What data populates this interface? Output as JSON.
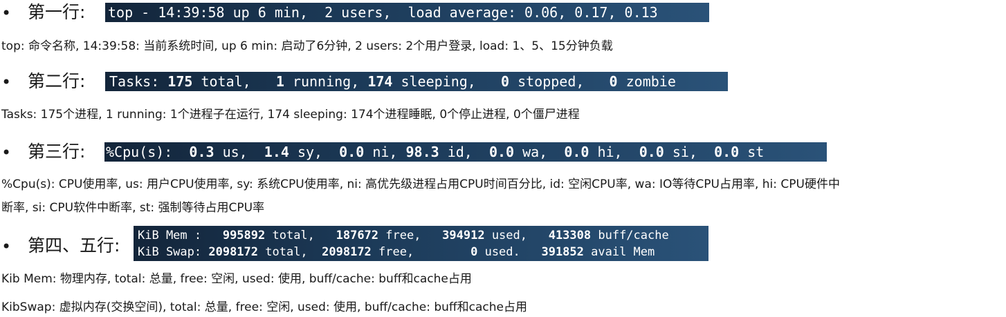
{
  "sections": [
    {
      "bullet": "•",
      "heading": "第一行:",
      "terminal": {
        "lines": [
          [
            {
              "t": "top - 14:39:58 up 6 min,  2 users,  load average: 0.06, 0.17, 0.13",
              "b": false
            }
          ]
        ]
      },
      "description": [
        "top: 命令名称, 14:39:58: 当前系统时间, up 6 min: 启动了6分钟, 2 users: 2个用户登录, load: 1、5、15分钟负载"
      ]
    },
    {
      "bullet": "•",
      "heading": "第二行:",
      "terminal": {
        "lines": [
          [
            {
              "t": "Tasks: ",
              "b": false
            },
            {
              "t": "175",
              "b": true
            },
            {
              "t": " total,   ",
              "b": false
            },
            {
              "t": "1",
              "b": true
            },
            {
              "t": " running, ",
              "b": false
            },
            {
              "t": "174",
              "b": true
            },
            {
              "t": " sleeping,   ",
              "b": false
            },
            {
              "t": "0",
              "b": true
            },
            {
              "t": " stopped,   ",
              "b": false
            },
            {
              "t": "0",
              "b": true
            },
            {
              "t": " zombie",
              "b": false
            }
          ]
        ]
      },
      "description": [
        "Tasks: 175个进程, 1 running: 1个进程子在运行, 174 sleeping: 174个进程睡眠, 0个停止进程, 0个僵尸进程"
      ]
    },
    {
      "bullet": "•",
      "heading": "第三行:",
      "terminal": {
        "lines": [
          [
            {
              "t": "%Cpu(s):  ",
              "b": false
            },
            {
              "t": "0.3",
              "b": true
            },
            {
              "t": " us,  ",
              "b": false
            },
            {
              "t": "1.4",
              "b": true
            },
            {
              "t": " sy,  ",
              "b": false
            },
            {
              "t": "0.0",
              "b": true
            },
            {
              "t": " ni, ",
              "b": false
            },
            {
              "t": "98.3",
              "b": true
            },
            {
              "t": " id,  ",
              "b": false
            },
            {
              "t": "0.0",
              "b": true
            },
            {
              "t": " wa,  ",
              "b": false
            },
            {
              "t": "0.0",
              "b": true
            },
            {
              "t": " hi,  ",
              "b": false
            },
            {
              "t": "0.0",
              "b": true
            },
            {
              "t": " si,  ",
              "b": false
            },
            {
              "t": "0.0",
              "b": true
            },
            {
              "t": " st",
              "b": false
            }
          ]
        ]
      },
      "description": [
        "%Cpu(s): CPU使用率, us: 用户CPU使用率, sy: 系统CPU使用率, ni: 高优先级进程占用CPU时间百分比, id: 空闲CPU率, wa: IO等待CPU占用率, hi: CPU硬件中",
        "断率, si: CPU软件中断率, st: 强制等待占用CPU率"
      ]
    },
    {
      "bullet": "•",
      "heading": "第四、五行:",
      "terminal": {
        "lines": [
          [
            {
              "t": "KiB Mem :   ",
              "b": false
            },
            {
              "t": "995892",
              "b": true
            },
            {
              "t": " total,   ",
              "b": false
            },
            {
              "t": "187672",
              "b": true
            },
            {
              "t": " free,   ",
              "b": false
            },
            {
              "t": "394912",
              "b": true
            },
            {
              "t": " used,   ",
              "b": false
            },
            {
              "t": "413308",
              "b": true
            },
            {
              "t": " buff/cache",
              "b": false
            }
          ],
          [
            {
              "t": "KiB Swap: ",
              "b": false
            },
            {
              "t": "2098172",
              "b": true
            },
            {
              "t": " total,  ",
              "b": false
            },
            {
              "t": "2098172",
              "b": true
            },
            {
              "t": " free,        ",
              "b": false
            },
            {
              "t": "0",
              "b": true
            },
            {
              "t": " used.   ",
              "b": false
            },
            {
              "t": "391852",
              "b": true
            },
            {
              "t": " avail Mem",
              "b": false
            }
          ]
        ]
      },
      "description": [
        "Kib Mem: 物理内存, total: 总量, free: 空闲, used: 使用, buff/cache: buff和cache占用",
        "KibSwap: 虚拟内存(交换空间), total: 总量, free: 空闲, used: 使用, buff/cache: buff和cache占用"
      ]
    }
  ]
}
